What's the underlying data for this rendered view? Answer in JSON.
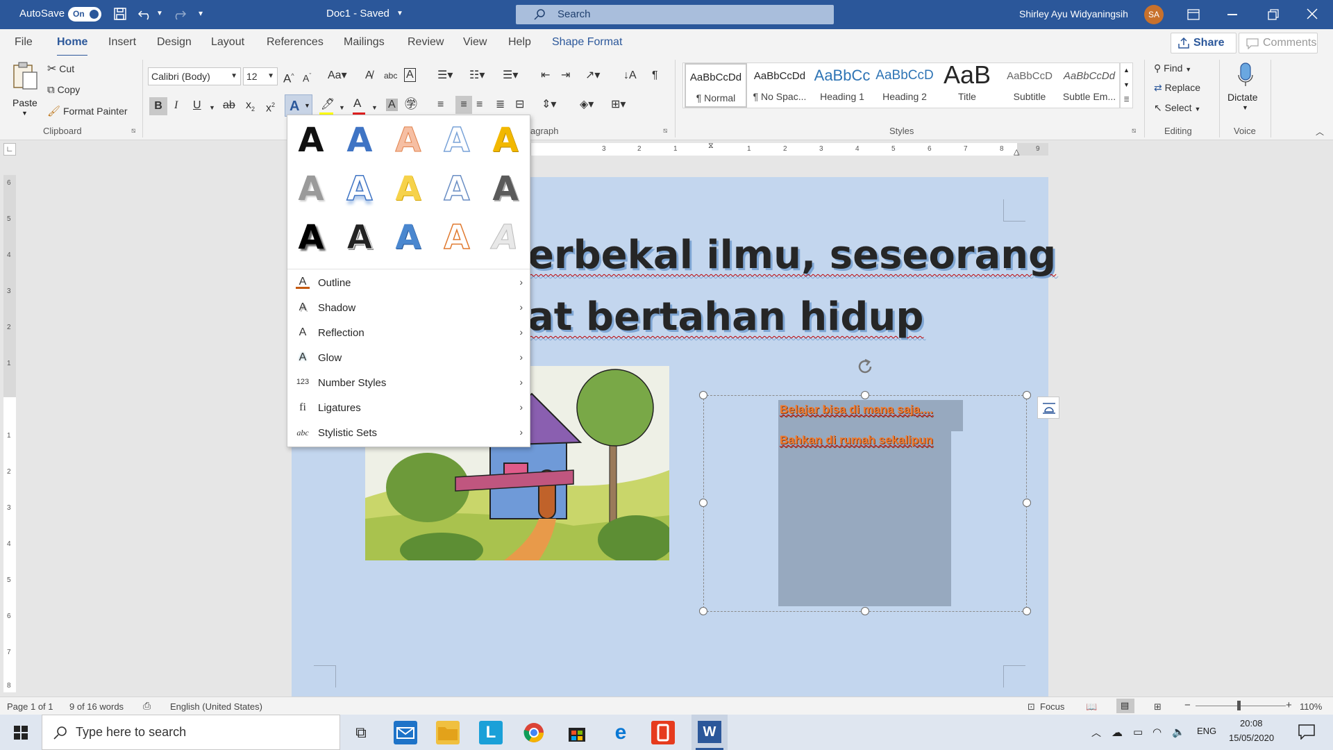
{
  "titlebar": {
    "autosave_label": "AutoSave",
    "autosave_state": "On",
    "doc_title": "Doc1  -  Saved",
    "search_placeholder": "Search",
    "user_name": "Shirley Ayu Widyaningsih",
    "user_initials": "SA"
  },
  "tabs": [
    "File",
    "Home",
    "Insert",
    "Design",
    "Layout",
    "References",
    "Mailings",
    "Review",
    "View",
    "Help",
    "Shape Format"
  ],
  "active_tab": "Home",
  "share_label": "Share",
  "comments_label": "Comments",
  "clipboard": {
    "paste": "Paste",
    "cut": "Cut",
    "copy": "Copy",
    "format_painter": "Format Painter",
    "group": "Clipboard"
  },
  "font": {
    "name": "Calibri (Body)",
    "size": "12",
    "group": "Font"
  },
  "paragraph_group": "Paragraph",
  "styles": {
    "group": "Styles",
    "items": [
      {
        "preview": "AaBbCcDd",
        "name": "¶ Normal"
      },
      {
        "preview": "AaBbCcDd",
        "name": "¶ No Spac..."
      },
      {
        "preview": "AaBbCc",
        "name": "Heading 1"
      },
      {
        "preview": "AaBbCcD",
        "name": "Heading 2"
      },
      {
        "preview": "AaB",
        "name": "Title"
      },
      {
        "preview": "AaBbCcD",
        "name": "Subtitle"
      },
      {
        "preview": "AaBbCcDd",
        "name": "Subtle Em..."
      }
    ]
  },
  "editing": {
    "find": "Find",
    "replace": "Replace",
    "select": "Select",
    "group": "Editing"
  },
  "voice": {
    "dictate": "Dictate",
    "group": "Voice"
  },
  "text_effects_menu": {
    "glyph": "A",
    "items": [
      {
        "label": "Outline",
        "icon": "A"
      },
      {
        "label": "Shadow",
        "icon": "A"
      },
      {
        "label": "Reflection",
        "icon": "A"
      },
      {
        "label": "Glow",
        "icon": "A"
      },
      {
        "label": "Number Styles",
        "icon": "123"
      },
      {
        "label": "Ligatures",
        "icon": "fi"
      },
      {
        "label": "Stylistic Sets",
        "icon": "abc"
      }
    ]
  },
  "document": {
    "heading_line1": "erbekal ilmu, seseorang",
    "heading_line2": "at bertahan hidup",
    "shape_text_line1": "Belajar bisa di mana saja....",
    "shape_text_line2": "Bahkan di rumah sekalipun"
  },
  "ruler": {
    "h_ticks": [
      "3",
      "2",
      "1",
      "1",
      "2",
      "3",
      "4",
      "5",
      "6",
      "7",
      "8",
      "9"
    ],
    "v_ticks": [
      "6",
      "5",
      "4",
      "3",
      "2",
      "1",
      "1",
      "2",
      "3",
      "4",
      "5",
      "6",
      "7",
      "8"
    ]
  },
  "statusbar": {
    "page": "Page 1 of 1",
    "words": "9 of 16 words",
    "language": "English (United States)",
    "focus": "Focus",
    "zoom": "110%"
  },
  "taskbar": {
    "search_placeholder": "Type here to search",
    "lang": "ENG",
    "time": "20:08",
    "date": "15/05/2020"
  },
  "colors": {
    "accent": "#2b579a",
    "page": "#c3d6ee",
    "shape_fill": "#97a9bf",
    "shape_text": "#f07a2e"
  }
}
